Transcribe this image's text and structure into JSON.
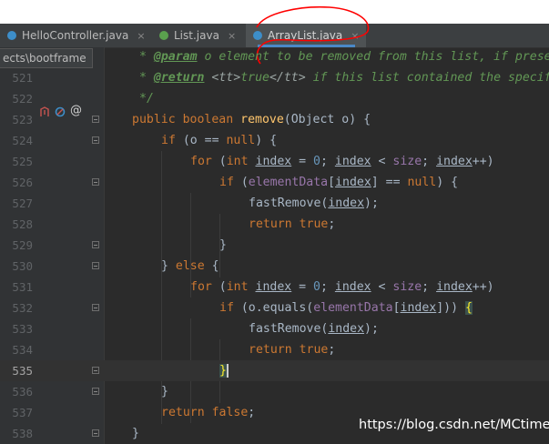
{
  "tabs": [
    {
      "label": "HelloController.java",
      "icon": "java-class-icon",
      "active": false
    },
    {
      "label": "List.java",
      "icon": "java-interface-icon",
      "active": false
    },
    {
      "label": "ArrayList.java",
      "icon": "java-class-icon",
      "active": true
    }
  ],
  "tab_close_glyph": "×",
  "breadcrumb": "ects\\bootframe",
  "gutter_marker": "@",
  "annotation_color": "#ff0000",
  "watermark": "https://blog.csdn.net/MCtime",
  "lines": [
    {
      "num": "",
      "text": "* @param o element to be removed from this list, if present"
    },
    {
      "num": "521",
      "text": "* @return <tt>true</tt> if this list contained the specified element"
    },
    {
      "num": "522",
      "text": "*/"
    },
    {
      "num": "523",
      "text": "public boolean remove(Object o) {"
    },
    {
      "num": "524",
      "text": "if (o == null) {"
    },
    {
      "num": "525",
      "text": "for (int index = 0; index < size; index++)"
    },
    {
      "num": "526",
      "text": "if (elementData[index] == null) {"
    },
    {
      "num": "527",
      "text": "fastRemove(index);"
    },
    {
      "num": "528",
      "text": "return true;"
    },
    {
      "num": "529",
      "text": "}"
    },
    {
      "num": "530",
      "text": "} else {"
    },
    {
      "num": "531",
      "text": "for (int index = 0; index < size; index++)"
    },
    {
      "num": "532",
      "text": "if (o.equals(elementData[index])) {"
    },
    {
      "num": "533",
      "text": "fastRemove(index);"
    },
    {
      "num": "534",
      "text": "return true;"
    },
    {
      "num": "535",
      "text": "}"
    },
    {
      "num": "536",
      "text": "}"
    },
    {
      "num": "537",
      "text": "return false;"
    },
    {
      "num": "538",
      "text": "}"
    }
  ]
}
